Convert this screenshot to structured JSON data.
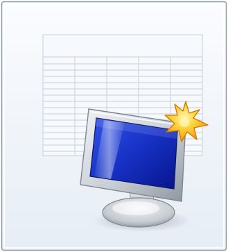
{
  "icon": {
    "description_name": "new-monitor-config-document-icon",
    "colors": {
      "page_fill_top": "#f9fbfd",
      "page_fill_bottom": "#e7eef6",
      "page_border": "#8e9aa8",
      "grid_line": "#c9d3de",
      "monitor_bezel_light": "#e4e8ec",
      "monitor_bezel_dark": "#a7afb8",
      "screen_dark": "#0a1c9e",
      "screen_light": "#2c4ee6",
      "star_fill": "#ffc21a",
      "star_edge": "#d77a00"
    }
  }
}
